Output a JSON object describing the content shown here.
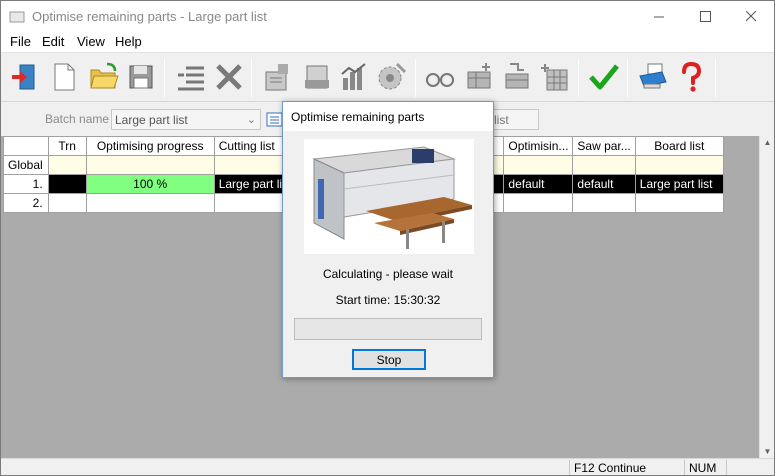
{
  "window": {
    "title": "Optimise remaining parts - Large part list"
  },
  "menu": {
    "items": [
      "File",
      "Edit",
      "View",
      "Help"
    ]
  },
  "toolbar": {
    "icons": [
      "exit-icon",
      "new-icon",
      "open-icon",
      "save-icon",
      "list-icon",
      "delete-icon",
      "report-icon",
      "print-preview-icon",
      "chart-icon",
      "saw-icon",
      "find-icon",
      "add-parts-icon",
      "edit-parts-icon",
      "grid-icon",
      "check-icon",
      "printer-icon",
      "help-icon"
    ]
  },
  "batch": {
    "label": "Batch name",
    "value": "Large part list",
    "right_value": "list"
  },
  "grid": {
    "columns": [
      "Trn",
      "Optimising progress",
      "Cutting list",
      "Optimisin...",
      "Saw par...",
      "Board list"
    ],
    "rows": [
      {
        "head": "Global",
        "trn": "",
        "progress": "",
        "cutting": "",
        "optimising": "",
        "saw": "",
        "board": ""
      },
      {
        "head": "1.",
        "trn": "",
        "progress": "100 %",
        "cutting": "Large part list",
        "optimising": "default",
        "saw": "default",
        "board": "Large part list"
      },
      {
        "head": "2.",
        "trn": "",
        "progress": "",
        "cutting": "",
        "optimising": "",
        "saw": "",
        "board": ""
      }
    ]
  },
  "status": {
    "continue": "F12 Continue",
    "num": "NUM"
  },
  "dialog": {
    "title": "Optimise remaining parts",
    "calculating": "Calculating - please wait",
    "start_time": "Start time: 15:30:32",
    "progress": 0,
    "stop_label": "Stop"
  },
  "colors": {
    "progress_done": "#80ff80",
    "accent": "#0078d7",
    "selected_row": "#000000",
    "global_row": "#fffde6"
  }
}
